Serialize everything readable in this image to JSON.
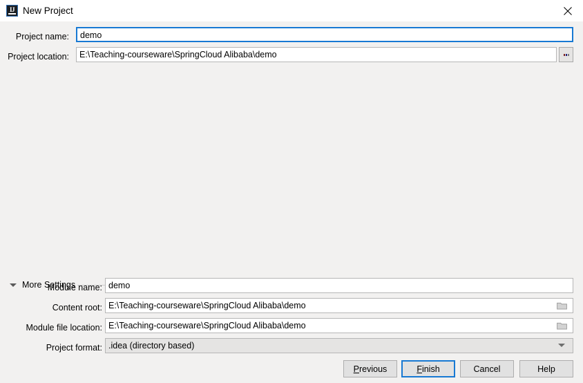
{
  "window": {
    "title": "New Project",
    "app_icon": "intellij-idea-icon",
    "icon_glyph": "IJ",
    "close_icon": "close-icon"
  },
  "colors": {
    "titlebar_bg": "#ffffff",
    "dialog_bg": "#f2f1f0",
    "focus_blue": "#1779d3",
    "field_bg": "#ffffff",
    "combo_bg": "#e5e4e3",
    "border_gray": "#b6b6b6",
    "separator": "#cdcdcd"
  },
  "top_form": {
    "project_name": {
      "label": "Project name:",
      "value": "demo",
      "placeholder": "",
      "focused": true
    },
    "project_location": {
      "label": "Project location:",
      "value": "E:\\Teaching-courseware\\SpringCloud Alibaba\\demo",
      "placeholder": "",
      "focused": false
    },
    "browse_button": {
      "label": "...",
      "icon": "ellipsis-icon"
    }
  },
  "more_settings": {
    "title": "More Settings",
    "expanded": true,
    "toggle_icon": "triangle-down-icon",
    "fields": {
      "module_name": {
        "label": "Module name:",
        "value": "demo",
        "placeholder": "",
        "trailing_icon": ""
      },
      "content_root": {
        "label": "Content root:",
        "value": "E:\\Teaching-courseware\\SpringCloud Alibaba\\demo",
        "placeholder": "",
        "trailing_icon": "folder-icon"
      },
      "module_file_location": {
        "label": "Module file location:",
        "value": "E:\\Teaching-courseware\\SpringCloud Alibaba\\demo",
        "placeholder": "",
        "trailing_icon": "folder-icon"
      },
      "project_format": {
        "label": "Project format:",
        "value": ".idea (directory based)",
        "dropdown_icon": "chevron-down-icon",
        "options": [
          ".idea (directory based)"
        ]
      }
    }
  },
  "buttons": {
    "previous": {
      "label": "Previous",
      "mnemonic": "P",
      "default": false
    },
    "finish": {
      "label": "Finish",
      "mnemonic": "F",
      "default": true
    },
    "cancel": {
      "label": "Cancel",
      "mnemonic": "",
      "default": false
    },
    "help": {
      "label": "Help",
      "mnemonic": "",
      "default": false
    }
  }
}
